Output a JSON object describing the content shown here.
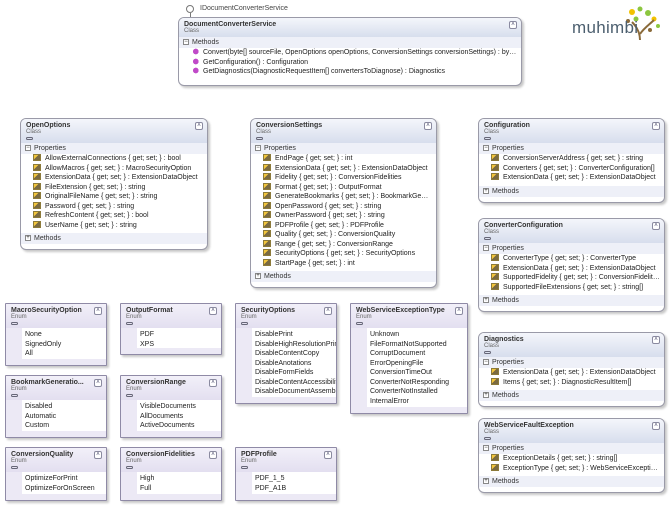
{
  "logo": {
    "text": "muhimbi",
    "colors": [
      "#8cc63f",
      "#f2c200",
      "#8a6a3a",
      "#4c5f6f"
    ]
  },
  "interface": {
    "label": "IDocumentConverterService"
  },
  "classes": [
    {
      "name": "DocumentConverterService",
      "kind": "Class",
      "sections": [
        {
          "label": "Methods",
          "expanded": true,
          "type": "meth",
          "members": [
            "Convert(byte[] sourceFile, OpenOptions openOptions, ConversionSettings conversionSettings) : byte[]",
            "GetConfiguration() : Configuration",
            "GetDiagnostics(DiagnosticRequestItem[] convertersToDiagnose) : Diagnostics"
          ]
        }
      ]
    },
    {
      "name": "OpenOptions",
      "kind": "Class",
      "sections": [
        {
          "label": "Properties",
          "expanded": true,
          "type": "prop",
          "members": [
            "AllowExternalConnections { get; set; } : bool",
            "AllowMacros { get; set; } : MacroSecurityOption",
            "ExtensionData { get; set; } : ExtensionDataObject",
            "FileExtension { get; set; } : string",
            "OriginalFileName { get; set; } : string",
            "Password { get; set; } : string",
            "RefreshContent { get; set; } : bool",
            "UserName { get; set; } : string"
          ]
        },
        {
          "label": "Methods",
          "expanded": false
        }
      ]
    },
    {
      "name": "ConversionSettings",
      "kind": "Class",
      "sections": [
        {
          "label": "Properties",
          "expanded": true,
          "type": "prop",
          "members": [
            "EndPage { get; set; } : int",
            "ExtensionData { get; set; } : ExtensionDataObject",
            "Fidelity { get; set; } : ConversionFidelities",
            "Format { get; set; } : OutputFormat",
            "GenerateBookmarks { get; set; } : BookmarkGener...",
            "OpenPassword { get; set; } : string",
            "OwnerPassword { get; set; } : string",
            "PDFProfile { get; set; } : PDFProfile",
            "Quality { get; set; } : ConversionQuality",
            "Range { get; set; } : ConversionRange",
            "SecurityOptions { get; set; } : SecurityOptions",
            "StartPage { get; set; } : int"
          ]
        },
        {
          "label": "Methods",
          "expanded": false
        }
      ]
    },
    {
      "name": "Configuration",
      "kind": "Class",
      "sections": [
        {
          "label": "Properties",
          "expanded": true,
          "type": "prop",
          "members": [
            "ConversionServerAddress { get; set; } : string",
            "Converters { get; set; } : ConverterConfiguration[]",
            "ExtensionData { get; set; } : ExtensionDataObject"
          ]
        },
        {
          "label": "Methods",
          "expanded": false
        }
      ]
    },
    {
      "name": "ConverterConfiguration",
      "kind": "Class",
      "sections": [
        {
          "label": "Properties",
          "expanded": true,
          "type": "prop",
          "members": [
            "ConverterType { get; set; } : ConverterType",
            "ExtensionData { get; set; } : ExtensionDataObject",
            "SupportedFidelity { get; set; } : ConversionFidelities",
            "SupportedFileExtensions { get; set; } : string[]"
          ]
        },
        {
          "label": "Methods",
          "expanded": false
        }
      ]
    },
    {
      "name": "Diagnostics",
      "kind": "Class",
      "sections": [
        {
          "label": "Properties",
          "expanded": true,
          "type": "prop",
          "members": [
            "ExtensionData { get; set; } : ExtensionDataObject",
            "Items { get; set; } : DiagnosticResultItem[]"
          ]
        },
        {
          "label": "Methods",
          "expanded": false
        }
      ]
    },
    {
      "name": "WebServiceFaultException",
      "kind": "Class",
      "sections": [
        {
          "label": "Properties",
          "expanded": true,
          "type": "prop",
          "members": [
            "ExceptionDetails { get; set; } : string[]",
            "ExceptionType { get; set; } : WebServiceException..."
          ]
        },
        {
          "label": "Methods",
          "expanded": false
        }
      ]
    }
  ],
  "enums": [
    {
      "name": "MacroSecurityOption",
      "kind": "Enum",
      "items": [
        "None",
        "SignedOnly",
        "All"
      ]
    },
    {
      "name": "OutputFormat",
      "kind": "Enum",
      "items": [
        "PDF",
        "XPS"
      ]
    },
    {
      "name": "SecurityOptions",
      "kind": "Enum",
      "items": [
        "DisablePrint",
        "DisableHighResolutionPrint",
        "DisableContentCopy",
        "DisableAnotations",
        "DisableFormFields",
        "DisableContentAccessibility",
        "DisableDocumentAssembly"
      ]
    },
    {
      "name": "WebServiceExceptionType",
      "kind": "Enum",
      "items": [
        "Unknown",
        "FileFormatNotSupported",
        "CorruptDocument",
        "ErrorOpeningFile",
        "ConversionTimeOut",
        "ConverterNotResponding",
        "ConverterNotInstalled",
        "InternalError"
      ]
    },
    {
      "name": "BookmarkGeneratio...",
      "kind": "Enum",
      "items": [
        "Disabled",
        "Automatic",
        "Custom"
      ]
    },
    {
      "name": "ConversionRange",
      "kind": "Enum",
      "items": [
        "VisibleDocuments",
        "AllDocuments",
        "ActiveDocuments"
      ]
    },
    {
      "name": "ConversionQuality",
      "kind": "Enum",
      "items": [
        "OptimizeForPrint",
        "OptimizeForOnScreen"
      ]
    },
    {
      "name": "ConversionFidelities",
      "kind": "Enum",
      "items": [
        "High",
        "Full"
      ]
    },
    {
      "name": "PDFProfile",
      "kind": "Enum",
      "items": [
        "PDF_1_5",
        "PDF_A1B"
      ]
    }
  ]
}
